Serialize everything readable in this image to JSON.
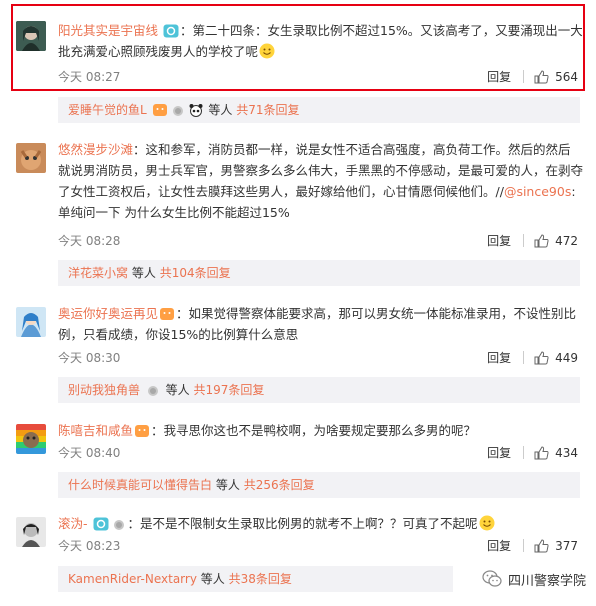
{
  "comments": [
    {
      "user": "阳光其实是宇宙线",
      "text": "：第二十四条：女生录取比例不超过15%。又该高考了，又要涌现出一大批充满爱心照顾残废男人的学校了呢",
      "time": "今天 08:27",
      "reply": "回复",
      "likes": "564",
      "sub": {
        "user": "爱睡午觉的鱼L",
        "text": "等人",
        "more": "共71条回复"
      }
    },
    {
      "user": "悠然漫步沙滩",
      "text": "：这和参军，消防员都一样，说是女性不适合高强度，高负荷工作。然后的然后就说男消防员，男士兵军官，男警察多么多么伟大，手黑黑的不停感动，是最可爱的人，在剥夺了女性工资权后，让女性去膜拜这些男人，最好嫁给他们，心甘情愿伺候他们。//",
      "mention": "@since90s",
      "text2": ":单纯问一下 为什么女生比例不能超过15%",
      "time": "今天 08:28",
      "reply": "回复",
      "likes": "472",
      "sub": {
        "user": "洋花菜小窝",
        "text": "等人",
        "more": "共104条回复"
      }
    },
    {
      "user": "奥运你好奥运再见",
      "text": "：如果觉得警察体能要求高，那可以男女统一体能标准录用，不设性别比例，只看成绩，你设15%的比例算什么意思",
      "time": "今天 08:30",
      "reply": "回复",
      "likes": "449",
      "sub": {
        "user": "别动我独角兽",
        "text": "等人",
        "more": "共197条回复"
      }
    },
    {
      "user": "陈嘻吉和咸鱼",
      "text": "：我寻思你这也不是鸭校啊，为啥要规定要那么多男的呢？",
      "time": "今天 08:40",
      "reply": "回复",
      "likes": "434",
      "sub": {
        "user": "什么时候真能可以懂得告白",
        "text": "等人",
        "more": "共256条回复"
      }
    },
    {
      "user": "滚沩-",
      "text": "：是不是不限制女生录取比例男的就考不上啊？？可真了不起呢",
      "time": "今天 08:23",
      "reply": "回复",
      "likes": "377",
      "sub": {
        "user": "KamenRider-Nextarry",
        "text": "等人",
        "more": "共38条回复"
      }
    }
  ],
  "watermark": "四川警察学院",
  "colors": {
    "username": "#eb7350",
    "highlight_box": "#e60012",
    "sub_bg": "#f2f2f5",
    "time": "#808080"
  },
  "icons": [
    "avatar",
    "verified-badge-icon",
    "medal-icon",
    "thumbs-up-icon",
    "smile-emoji-icon",
    "wechat-icon"
  ]
}
